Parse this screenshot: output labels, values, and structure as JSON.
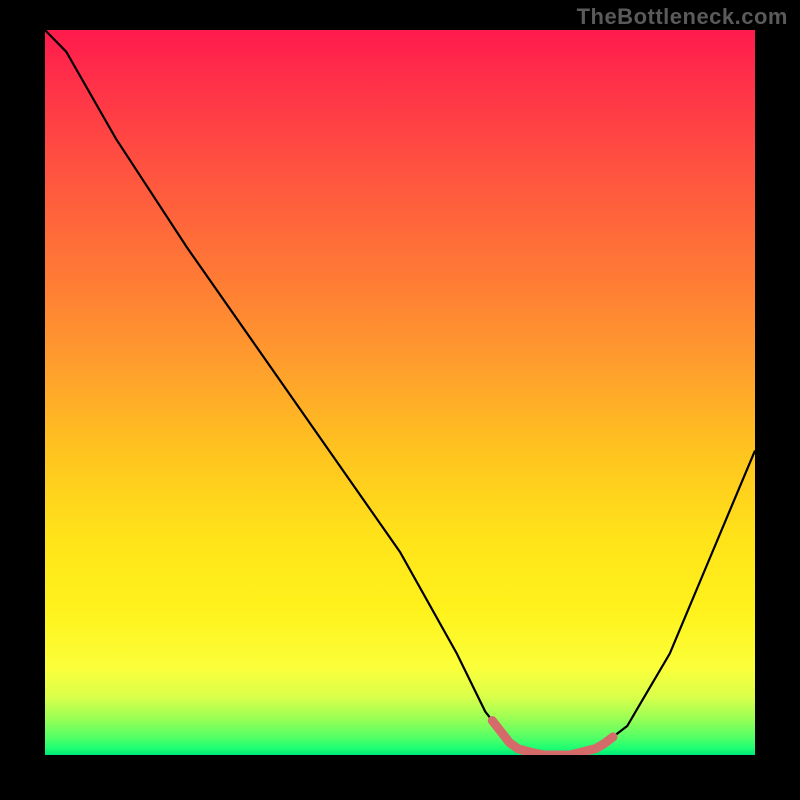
{
  "watermark": "TheBottleneck.com",
  "colors": {
    "curve": "#000000",
    "highlight": "#d46a6a",
    "background_frame": "#000000"
  },
  "chart_data": {
    "type": "line",
    "title": "",
    "xlabel": "",
    "ylabel": "",
    "xlim": [
      0,
      100
    ],
    "ylim": [
      0,
      100
    ],
    "grid": false,
    "legend": false,
    "notes": "V-shaped bottleneck curve over a vertical color gradient (red=high bottleneck at top, green=no bottleneck at bottom). Minimum (optimal zone) is highlighted with a thick salmon segment.",
    "series": [
      {
        "name": "bottleneck",
        "x": [
          0,
          3,
          10,
          20,
          30,
          40,
          50,
          58,
          62,
          66,
          70,
          74,
          78,
          82,
          88,
          94,
          100
        ],
        "y": [
          100,
          97,
          85,
          70,
          56,
          42,
          28,
          14,
          6,
          1,
          0,
          0,
          1,
          4,
          14,
          28,
          42
        ]
      }
    ],
    "optimal_range": {
      "x_start": 63,
      "x_end": 80
    }
  }
}
